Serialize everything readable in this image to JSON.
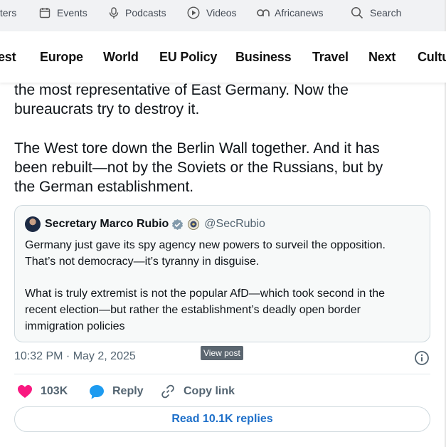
{
  "top_nav": {
    "items": [
      {
        "label": "tters",
        "icon": ""
      },
      {
        "label": "Events",
        "icon": "calendar-icon"
      },
      {
        "label": "Podcasts",
        "icon": "microphone-icon"
      },
      {
        "label": "Videos",
        "icon": "play-icon"
      },
      {
        "label": "Africanews",
        "icon": "africanews-logo-icon"
      },
      {
        "label": "Search",
        "icon": "search-icon"
      }
    ]
  },
  "main_nav": {
    "items": [
      "est",
      "Europe",
      "World",
      "EU Policy",
      "Business",
      "Travel",
      "Next",
      "Cultu"
    ]
  },
  "tweet": {
    "text_lines": [
      "the most representative of East Germany. Now the",
      "bureaucrats try to destroy it.",
      "The West tore down the Berlin Wall together. And it has",
      "been rebuilt—not by the Soviets or the Russians, but by",
      "the German establishment."
    ],
    "quote": {
      "name": "Secretary Marco Rubio",
      "handle": "@SecRubio",
      "lines": [
        "Germany just gave its spy agency new powers to surveil the opposition.",
        "That’s not democracy—it’s tyranny in disguise.",
        "What is truly extremist is not the popular AfD—which took second in the",
        "recent election—but rather the establishment’s deadly open border",
        "immigration policies"
      ]
    },
    "timestamp": "10:32 PM · May 2, 2025",
    "tooltip": "View post",
    "actions": {
      "likes": "103K",
      "reply": "Reply",
      "copy_link": "Copy link"
    },
    "read_replies": "Read 10.1K replies"
  },
  "colors": {
    "like": "#f91880",
    "reply": "#1d9bf0",
    "link": "#1d6fc9",
    "verified_badge": "#829aab"
  }
}
